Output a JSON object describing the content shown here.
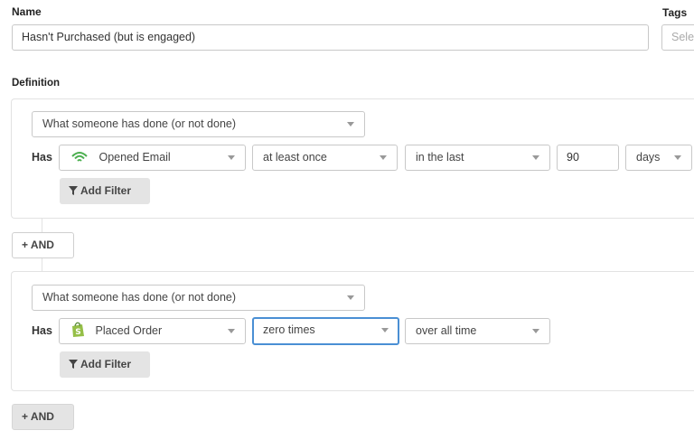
{
  "form": {
    "name_label": "Name",
    "name_value": "Hasn't Purchased (but is engaged)",
    "tags_label": "Tags",
    "tags_placeholder": "Sele",
    "definition_label": "Definition"
  },
  "conditions": [
    {
      "type_select": "What someone has done (or not done)",
      "has_label": "Has",
      "metric": "Opened Email",
      "metric_icon": "email-signal-icon",
      "frequency": "at least once",
      "timeframe": "in the last",
      "amount": "90",
      "unit": "days",
      "add_filter_label": "Add Filter"
    },
    {
      "type_select": "What someone has done (or not done)",
      "has_label": "Has",
      "metric": "Placed Order",
      "metric_icon": "shopify-icon",
      "frequency": "zero times",
      "timeframe": "over all time",
      "add_filter_label": "Add Filter"
    }
  ],
  "and_buttons": [
    "+ AND",
    "+ AND"
  ],
  "colors": {
    "focus_border": "#4a8fd4",
    "email_icon": "#4caf50",
    "shopify_icon": "#95bf47"
  }
}
